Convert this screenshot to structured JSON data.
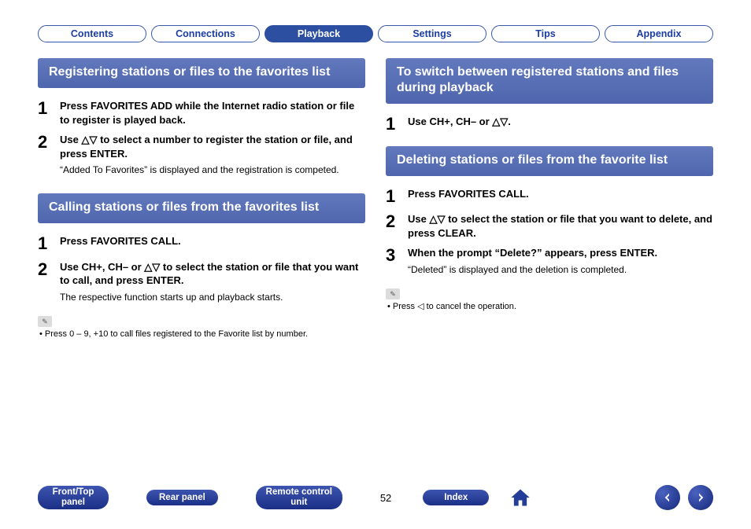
{
  "tabs": [
    {
      "label": "Contents",
      "active": false
    },
    {
      "label": "Connections",
      "active": false
    },
    {
      "label": "Playback",
      "active": true
    },
    {
      "label": "Settings",
      "active": false
    },
    {
      "label": "Tips",
      "active": false
    },
    {
      "label": "Appendix",
      "active": false
    }
  ],
  "left": {
    "section1": {
      "title": "Registering stations or files to the favorites list",
      "step1": "Press FAVORITES ADD while the Internet radio station or file to register is played back.",
      "step2": "Use △▽ to select a number to register the station or file, and press ENTER.",
      "step2_note": "“Added To Favorites” is displayed and the registration is competed."
    },
    "section2": {
      "title": "Calling stations or files from the favorites list",
      "step1": "Press FAVORITES CALL.",
      "step2": "Use CH+, CH– or △▽ to select the station or file that you want to call, and press ENTER.",
      "step2_note": "The respective function starts up and playback starts.",
      "footnote": "Press 0 – 9, +10 to call files registered to the Favorite list by number."
    }
  },
  "right": {
    "section1": {
      "title": "To switch between registered stations and files during playback",
      "step1": "Use CH+, CH– or △▽."
    },
    "section2": {
      "title": "Deleting stations or files from the favorite list",
      "step1": "Press FAVORITES CALL.",
      "step2": "Use △▽ to select the station or file that you want to delete, and press CLEAR.",
      "step3": "When the prompt “Delete?” appears, press ENTER.",
      "step3_note": "“Deleted” is displayed and the deletion is completed.",
      "footnote": "Press ◁ to cancel the operation."
    }
  },
  "bottom": {
    "b1": "Front/Top panel",
    "b2": "Rear panel",
    "b3": "Remote control unit",
    "page": "52",
    "b4": "Index"
  }
}
